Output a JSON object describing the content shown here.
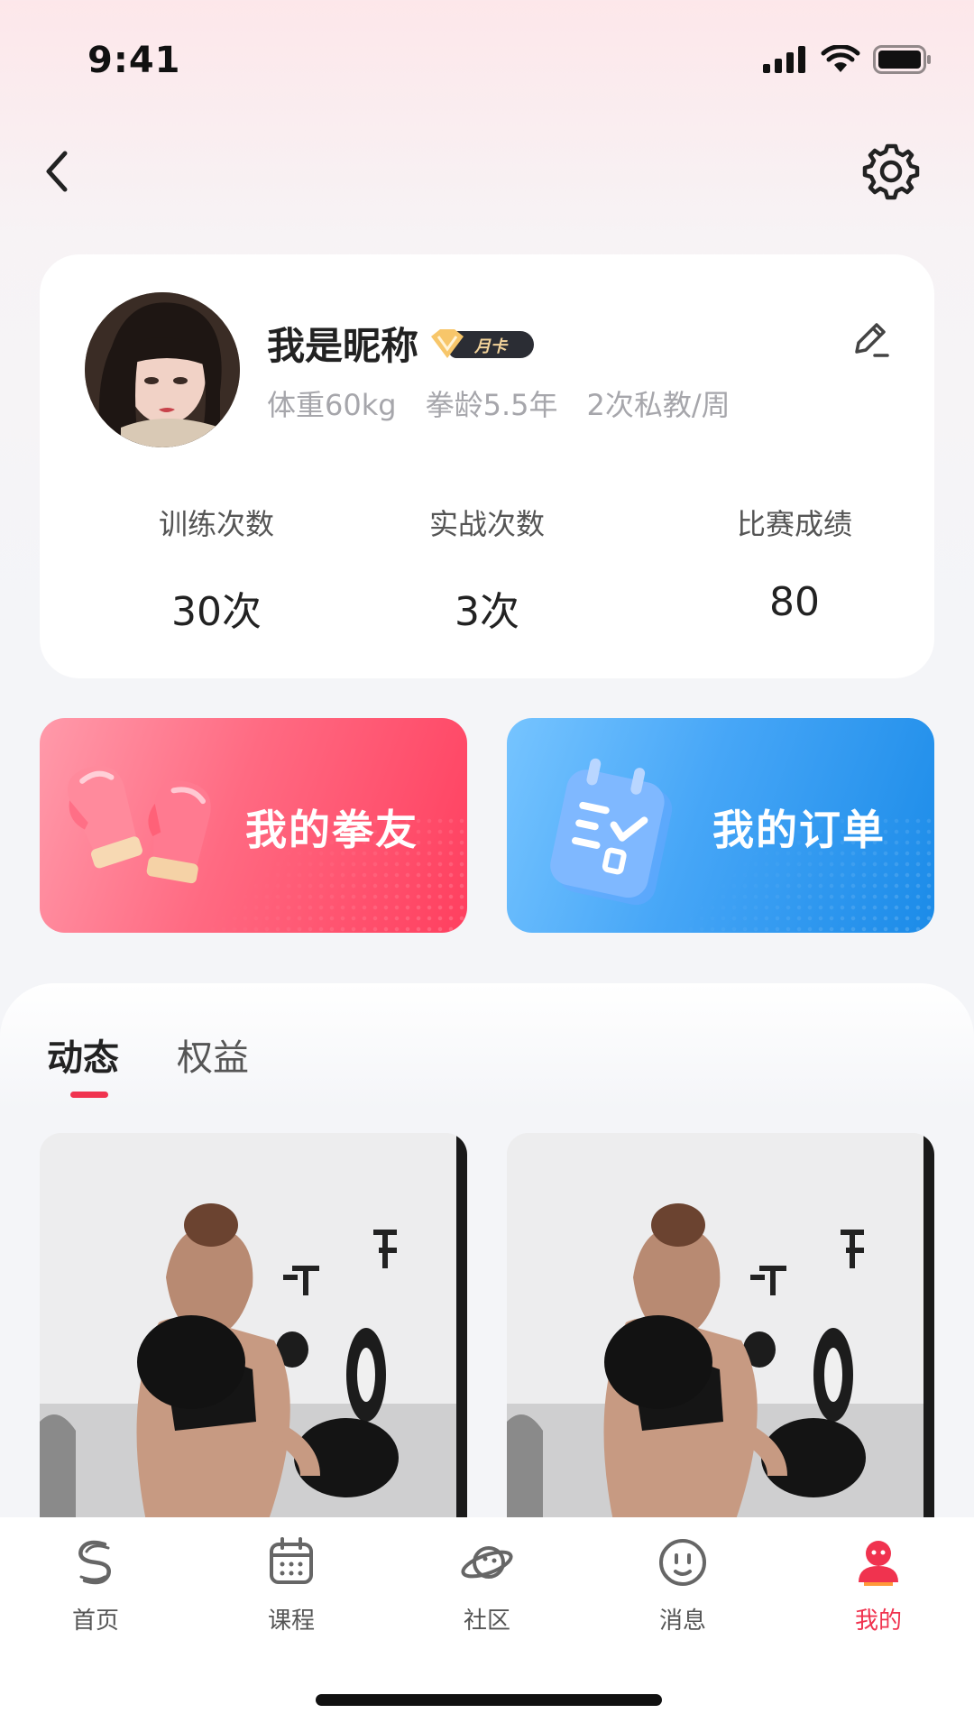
{
  "status_bar": {
    "time": "9:41"
  },
  "colors": {
    "accent": "#f0334f",
    "pink_card": "#ff5a75",
    "blue_card": "#2f96ef"
  },
  "profile": {
    "nickname": "我是昵称",
    "vip_label": "月卡",
    "meta": [
      "体重60kg",
      "拳龄5.5年",
      "2次私教/周"
    ],
    "stats": [
      {
        "label": "训练次数",
        "value": "30次"
      },
      {
        "label": "实战次数",
        "value": "3次"
      },
      {
        "label": "比赛成绩",
        "value": "80"
      }
    ]
  },
  "shortcuts": [
    {
      "label": "我的拳友",
      "icon": "boxing-gloves-icon"
    },
    {
      "label": "我的订单",
      "icon": "notepad-checklist-icon"
    }
  ],
  "feed": {
    "tabs": [
      {
        "label": "动态",
        "active": true
      },
      {
        "label": "权益",
        "active": false
      }
    ],
    "posts": [
      {
        "image": "boxer-photo"
      },
      {
        "image": "boxer-photo"
      }
    ]
  },
  "tab_bar": {
    "items": [
      {
        "label": "首页",
        "icon": "home-logo-icon",
        "active": false
      },
      {
        "label": "课程",
        "icon": "calendar-icon",
        "active": false
      },
      {
        "label": "社区",
        "icon": "planet-icon",
        "active": false
      },
      {
        "label": "消息",
        "icon": "smiley-icon",
        "active": false
      },
      {
        "label": "我的",
        "icon": "user-icon",
        "active": true
      }
    ]
  }
}
